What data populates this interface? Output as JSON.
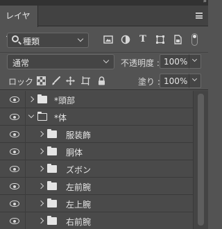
{
  "panel": {
    "tab_label": "レイヤー",
    "collapse_glyph": "»"
  },
  "filter": {
    "kind_label": "種類"
  },
  "blend": {
    "mode": "通常",
    "opacity_label": "不透明度 :",
    "opacity_value": "100%"
  },
  "lock": {
    "label": "ロック :",
    "fill_label": "塗り :",
    "fill_value": "100%"
  },
  "filter_text_icon": "T",
  "layers": [
    {
      "name": "*頭部",
      "indent": 0,
      "open": false,
      "visible": true
    },
    {
      "name": "*体",
      "indent": 0,
      "open": true,
      "visible": true
    },
    {
      "name": "服装飾",
      "indent": 1,
      "open": false,
      "visible": true
    },
    {
      "name": "胴体",
      "indent": 1,
      "open": false,
      "visible": true
    },
    {
      "name": "ズボン",
      "indent": 1,
      "open": false,
      "visible": true
    },
    {
      "name": "左前腕",
      "indent": 1,
      "open": false,
      "visible": true
    },
    {
      "name": "左上腕",
      "indent": 1,
      "open": false,
      "visible": true
    },
    {
      "name": "右前腕",
      "indent": 1,
      "open": false,
      "visible": true
    }
  ],
  "icons": {
    "filter": [
      "search-icon",
      "image-icon",
      "adjustment-icon",
      "type-icon",
      "shape-icon",
      "smart-object-icon"
    ],
    "lock": [
      "lock-transparency-icon",
      "lock-paint-icon",
      "lock-move-icon",
      "lock-artboard-icon",
      "lock-all-icon"
    ],
    "layer": [
      "eye-icon",
      "expand-arrow-icon",
      "folder-icon"
    ]
  }
}
